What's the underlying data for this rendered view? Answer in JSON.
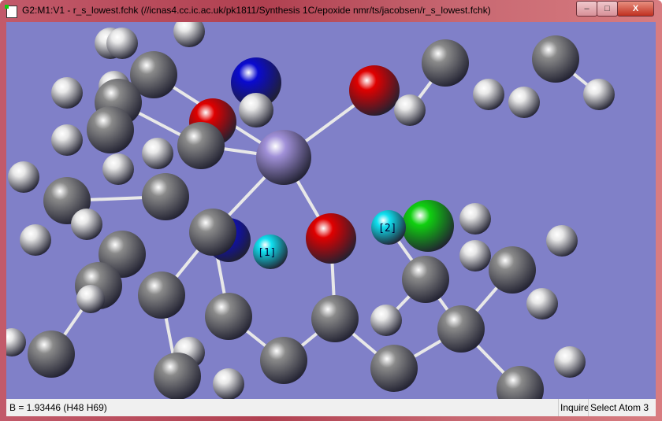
{
  "window": {
    "title": "G2:M1:V1 - r_s_lowest.fchk (//icnas4.cc.ic.ac.uk/pk1811/Synthesis 1C/epoxide nmr/ts/jacobsen/r_s_lowest.fchk)",
    "min": "–",
    "max": "□",
    "close": "X"
  },
  "viewer": {
    "background": "#8080c8",
    "atom_labels": [
      "[1]",
      "[2]"
    ],
    "colors": {
      "carbon": "#8a8a8a",
      "hydrogen": "#e8e8e8",
      "oxygen": "#e00000",
      "nitrogen": "#0a0ad0",
      "metal": "#a090d8",
      "chlorine": "#10d010",
      "selected": "#10e0f0"
    }
  },
  "status": {
    "text": "B = 1.93446 (H48 H69)",
    "mode": "Inquire",
    "select": "Select Atom 3"
  }
}
